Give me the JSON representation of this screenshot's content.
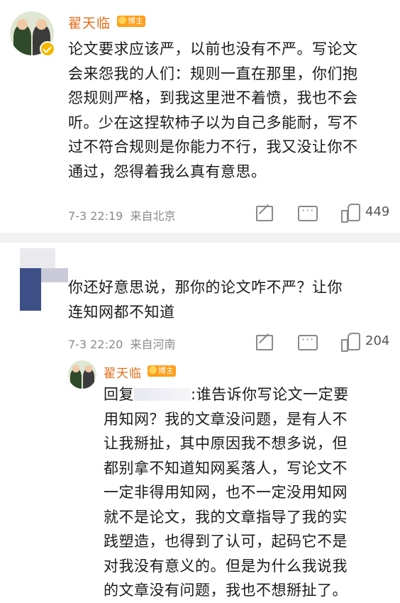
{
  "comments": [
    {
      "username": "翟天临",
      "badge": "博主",
      "text_lines": [
        "论文要求应该严，以前也没有不严。写论文",
        "会来怨我的人们：规则一直在那里，你们抱",
        "怨规则严格，到我这里泄不着愤，我也不会",
        "听。少在这捏软柿子以为自己多能耐，写不",
        "过不符合规则是你能力不行，我又没让你不",
        "通过，怨得着我么真有意思。"
      ],
      "time": "7-3 22:19",
      "location": "来自北京",
      "likes": "449"
    },
    {
      "username": "",
      "text_lines": [
        "你还好意思说，那你的论文咋不严？让你",
        "连知网都不知道"
      ],
      "time": "7-3 22:20",
      "location": "来自河南",
      "likes": "204",
      "reply": {
        "username": "翟天临",
        "badge": "博主",
        "reply_prefix": "回复",
        "reply_suffix": ":谁告诉你写论文一定要",
        "text_lines": [
          "用知网？我的文章没问题，是有人不",
          "让我掰扯，其中原因我不想多说，但",
          "都别拿不知道知网奚落人，写论文不",
          "一定非得用知网，也不一定没用知网",
          "就不是论文，我的文章指导了我的实",
          "践塑造，也得到了认可，起码它不是",
          "对我没有意义的。但是为什么我说我",
          "的文章没有问题，我也不想掰扯了。"
        ]
      }
    }
  ],
  "icons": {
    "share": "share-icon",
    "reply": "comment-icon",
    "like": "thumbs-up-icon",
    "verified": "verified-badge-icon"
  },
  "colors": {
    "username": "#e66b17",
    "badge_bg": "#ff9f1a",
    "meta": "#8a8a8a",
    "divider": "#f2f2f2"
  }
}
